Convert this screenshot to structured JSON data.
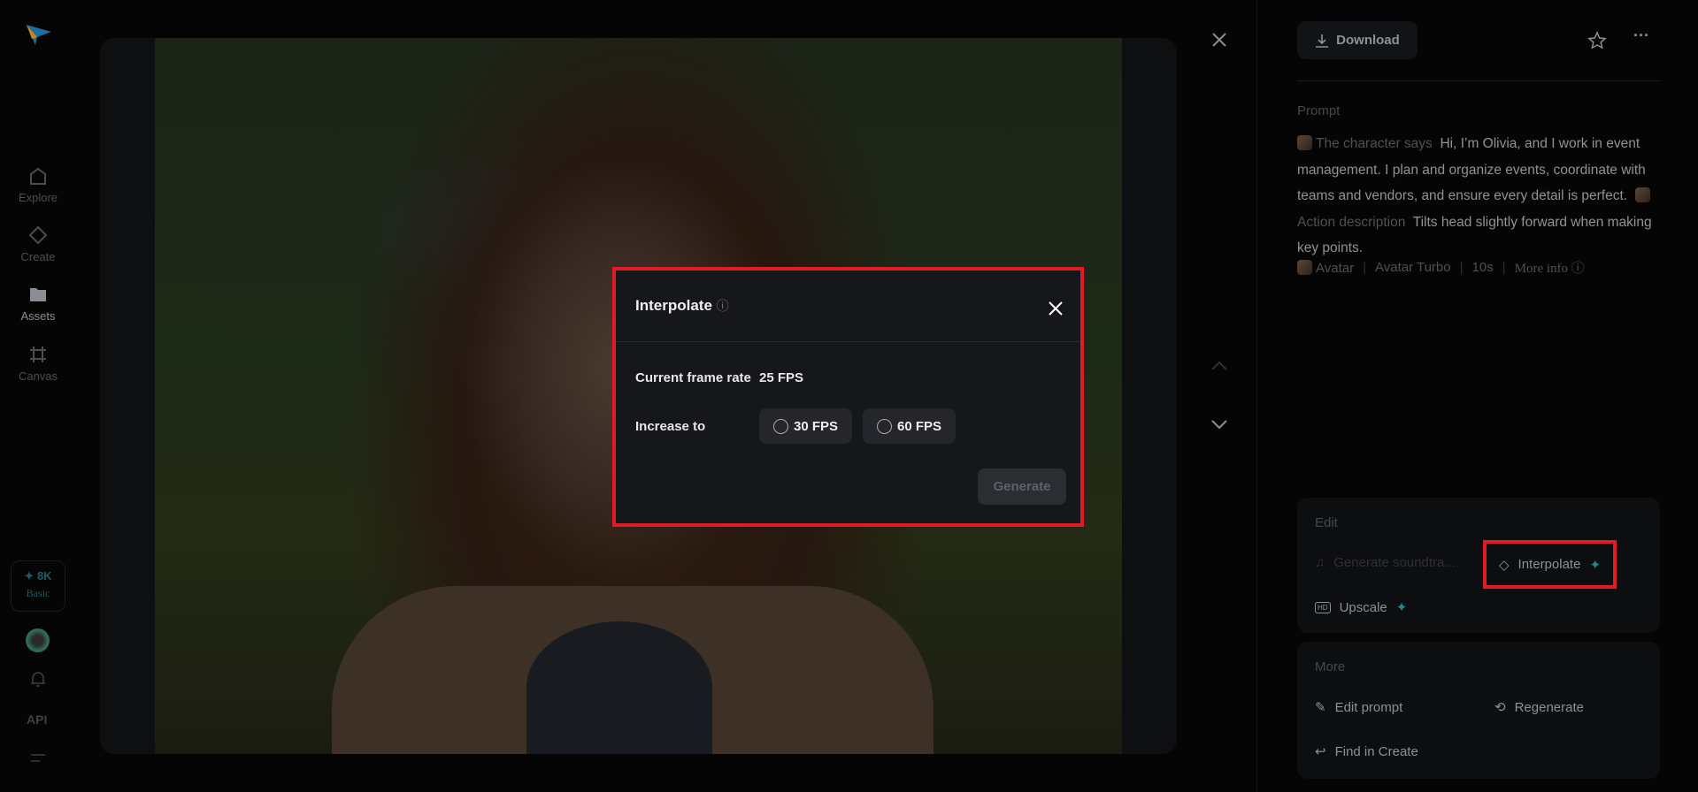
{
  "sidebar": {
    "items": [
      {
        "label": "Explore"
      },
      {
        "label": "Create"
      },
      {
        "label": "Assets"
      },
      {
        "label": "Canvas"
      }
    ],
    "credits": "8K",
    "plan": "Basic",
    "api": "API"
  },
  "modal": {
    "title": "Interpolate",
    "current_label": "Current frame rate",
    "current_value": "25 FPS",
    "increase_label": "Increase to",
    "options": [
      "30 FPS",
      "60 FPS"
    ],
    "generate": "Generate"
  },
  "right": {
    "download": "Download",
    "prompt_title": "Prompt",
    "prompt_tag1": "The character says",
    "prompt_text1": "Hi, I’m Olivia, and I work in event management. I plan and organize events, coordinate with teams and vendors, and ensure every detail is perfect.",
    "prompt_tag2": "Action description",
    "prompt_text2": "Tilts head slightly forward when making key points.",
    "meta": {
      "type": "Avatar",
      "model": "Avatar Turbo",
      "duration": "10s",
      "more": "More info"
    },
    "edit": {
      "title": "Edit",
      "soundtrack": "Generate soundtra...",
      "interpolate": "Interpolate",
      "upscale": "Upscale"
    },
    "more": {
      "title": "More",
      "edit_prompt": "Edit prompt",
      "regenerate": "Regenerate",
      "find": "Find in Create"
    }
  },
  "colors": {
    "accent": "#1f8a92",
    "highlight": "#e01b24"
  }
}
